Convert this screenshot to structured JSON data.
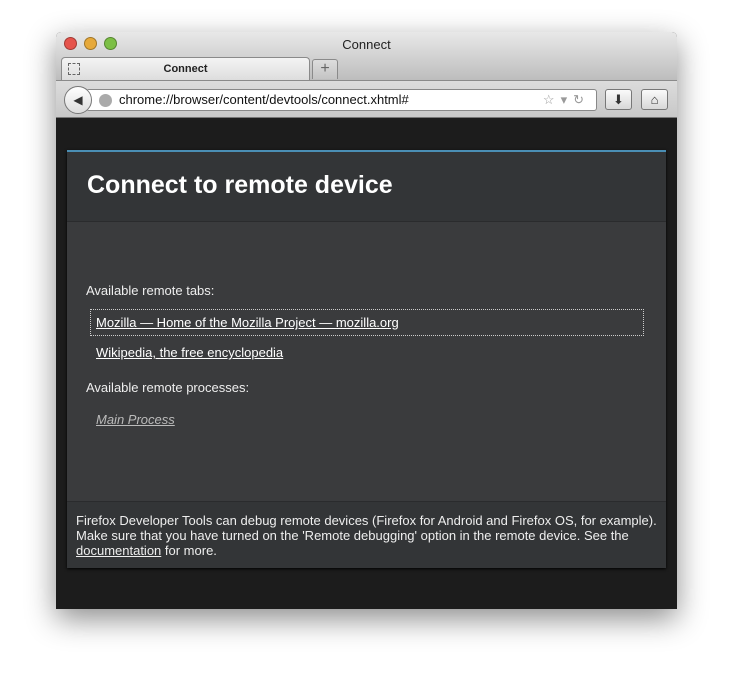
{
  "window": {
    "title": "Connect"
  },
  "tabs": [
    {
      "label": "Connect"
    }
  ],
  "new_tab_label": "+",
  "navbar": {
    "url": "chrome://browser/content/devtools/connect.xhtml#",
    "icons": [
      "back-icon",
      "globe-icon",
      "star-icon",
      "dropdown-icon",
      "reload-icon",
      "download-icon",
      "home-icon"
    ]
  },
  "page": {
    "heading": "Connect to remote device",
    "tabs_label": "Available remote tabs:",
    "remote_tabs": [
      "Mozilla — Home of the Mozilla Project — mozilla.org",
      "Wikipedia, the free encyclopedia"
    ],
    "processes_label": "Available remote processes:",
    "processes": [
      "Main Process"
    ],
    "footer": {
      "text_before": "Firefox Developer Tools can debug remote devices (Firefox for Android and Firefox OS, for example). Make sure that you have turned on the 'Remote debugging' option in the remote device. See the ",
      "link": "documentation",
      "text_after": " for more."
    }
  },
  "colors": {
    "accent": "#4a8eb4",
    "panel": "#3a3b3d",
    "header": "#333537"
  }
}
